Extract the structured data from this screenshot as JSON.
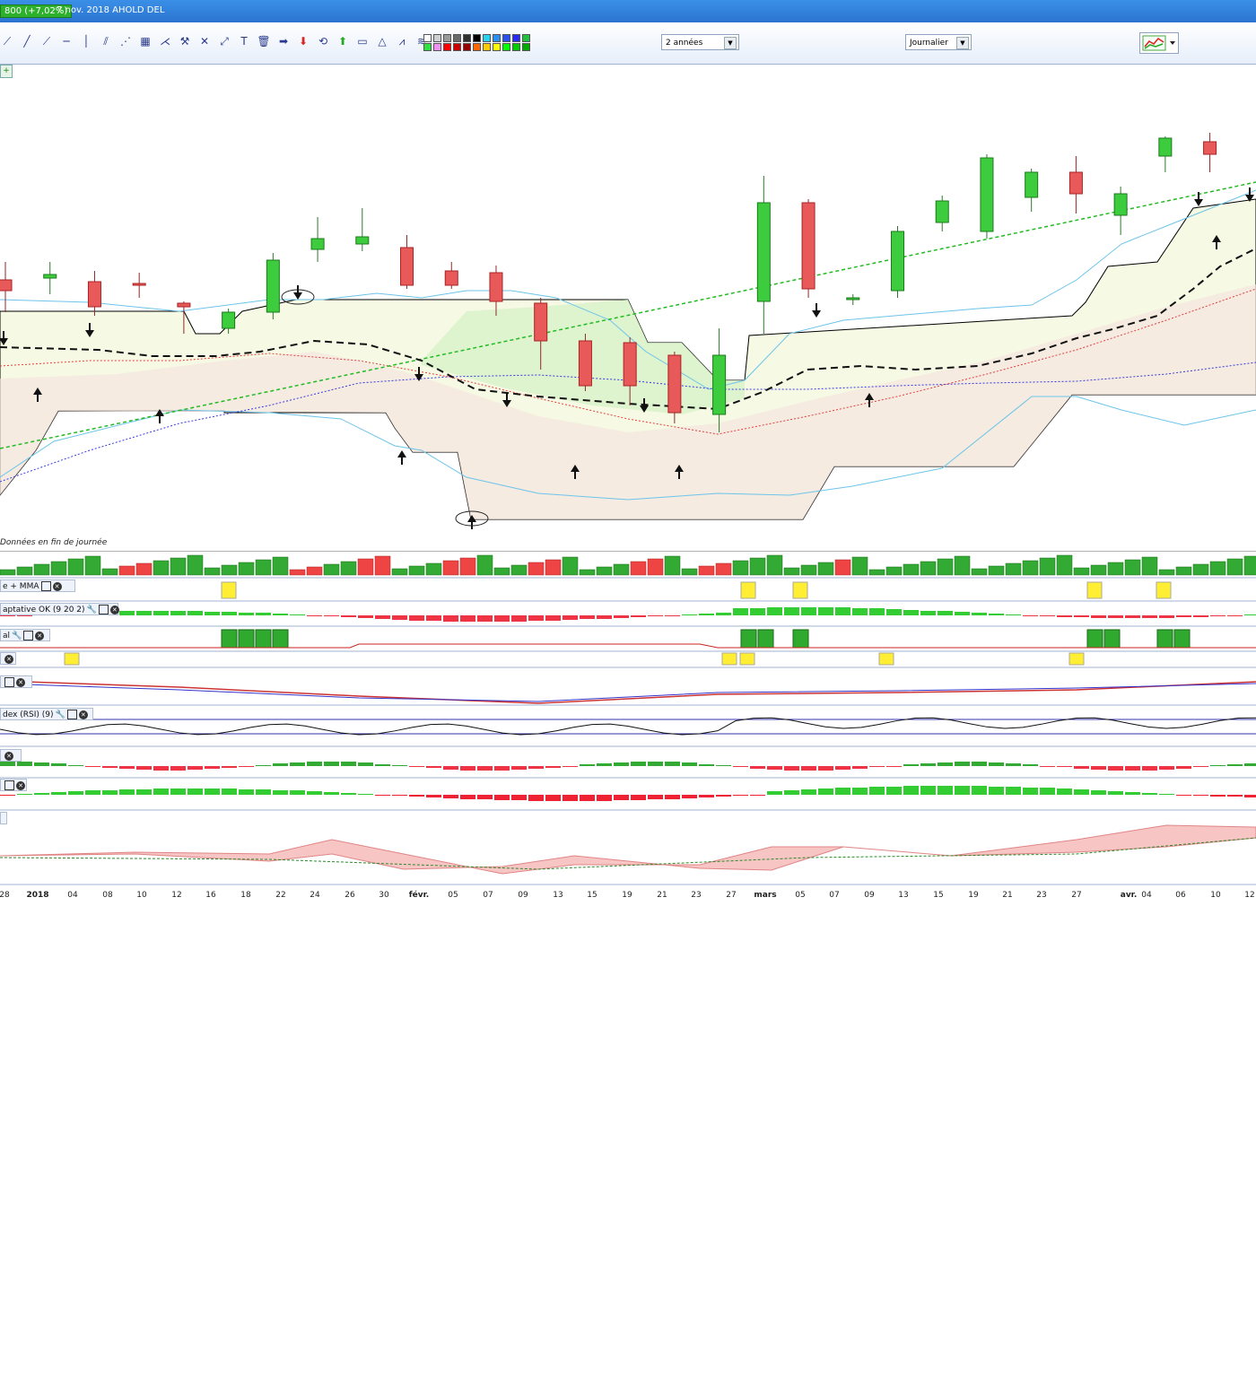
{
  "window": {
    "price_badge": "800 (+7,02%)",
    "title": "7 nov. 2018 AHOLD DEL"
  },
  "toolbar": {
    "period_value": "2 années",
    "interval_value": "Journalier",
    "drawing_tools": [
      "cursor-icon",
      "line-icon",
      "trendline-icon",
      "horizontal-line-icon",
      "vertical-line-icon",
      "channel-icon",
      "fan-icon",
      "grid-icon",
      "gann-icon",
      "hammer-icon",
      "cross-icon",
      "ray-icon",
      "text-icon",
      "trash-icon",
      "arrow-right-icon",
      "arrow-down-icon",
      "rotate-icon",
      "arrow-up-icon",
      "rectangle-icon",
      "triangle-icon",
      "zigzag-icon",
      "fibonacci-icon"
    ],
    "colors": [
      "#ffffff",
      "#d0d0d0",
      "#9a9a9a",
      "#6a6a6a",
      "#303030",
      "#000000",
      "#2ad0f0",
      "#2a90f0",
      "#2a50f0",
      "#2a2af0",
      "#20c040",
      "#30e040",
      "#f090f0",
      "#ff0000",
      "#cc0000",
      "#990000",
      "#ff6600",
      "#ffcc00",
      "#ffff00",
      "#00ff00",
      "#00cc00",
      "#00aa00"
    ]
  },
  "chart": {
    "data_note": "Données en fin de journée"
  },
  "panels": [
    {
      "label": "e + MMA"
    },
    {
      "label": "aptative OK (9 20 2)"
    },
    {
      "label": "al"
    },
    {
      "label": ""
    },
    {
      "label": ""
    },
    {
      "label": "dex (RSI) (9)"
    },
    {
      "label": ""
    },
    {
      "label": ""
    },
    {
      "label": ""
    }
  ],
  "x_axis": [
    "28",
    "2018",
    "04",
    "08",
    "10",
    "12",
    "16",
    "18",
    "22",
    "24",
    "26",
    "30",
    "févr.",
    "05",
    "07",
    "09",
    "13",
    "15",
    "19",
    "21",
    "23",
    "27",
    "mars",
    "05",
    "07",
    "09",
    "13",
    "15",
    "19",
    "21",
    "23",
    "27",
    "avr.",
    "04",
    "06",
    "10",
    "12"
  ],
  "chart_data": {
    "type": "candlestick",
    "title": "7 nov. 2018 AHOLD DEL",
    "x_labels": [
      "28",
      "2018",
      "04",
      "08",
      "10",
      "12",
      "16",
      "18",
      "22",
      "24",
      "26",
      "30",
      "févr.",
      "05",
      "07",
      "09",
      "13",
      "15",
      "19",
      "21",
      "23",
      "27",
      "mars",
      "05",
      "07",
      "09",
      "13",
      "15",
      "19",
      "21",
      "23",
      "27",
      "avr.",
      "04",
      "06",
      "10",
      "12"
    ],
    "series": [
      {
        "name": "",
        "bars": [
          {
            "o": 410,
            "c": 404,
            "h": 392,
            "l": 420
          },
          {
            "o": 411,
            "c": 413,
            "h": 402,
            "l": 420
          },
          {
            "o": 409,
            "c": 395,
            "h": 390,
            "l": 415
          },
          {
            "o": 408,
            "c": 407,
            "h": 400,
            "l": 414
          },
          {
            "o": 397,
            "c": 395,
            "h": 380,
            "l": 398
          },
          {
            "o": 383,
            "c": 392,
            "h": 380,
            "l": 394
          },
          {
            "o": 392,
            "c": 421,
            "h": 388,
            "l": 425
          },
          {
            "o": 427,
            "c": 433,
            "h": 420,
            "l": 445
          },
          {
            "o": 430,
            "c": 434,
            "h": 426,
            "l": 450
          },
          {
            "o": 428,
            "c": 407,
            "h": 405,
            "l": 435
          },
          {
            "o": 415,
            "c": 407,
            "h": 405,
            "l": 420
          },
          {
            "o": 414,
            "c": 398,
            "h": 390,
            "l": 418
          },
          {
            "o": 397,
            "c": 376,
            "h": 360,
            "l": 400
          },
          {
            "o": 376,
            "c": 351,
            "h": 348,
            "l": 380
          },
          {
            "o": 375,
            "c": 351,
            "h": 340,
            "l": 378
          },
          {
            "o": 368,
            "c": 336,
            "h": 330,
            "l": 370
          },
          {
            "o": 335,
            "c": 368,
            "h": 325,
            "l": 383
          },
          {
            "o": 398,
            "c": 453,
            "h": 380,
            "l": 468
          },
          {
            "o": 453,
            "c": 405,
            "h": 400,
            "l": 455
          },
          {
            "o": 399,
            "c": 400,
            "h": 396,
            "l": 402
          },
          {
            "o": 404,
            "c": 437,
            "h": 400,
            "l": 440
          },
          {
            "o": 442,
            "c": 454,
            "h": 437,
            "l": 457
          },
          {
            "o": 437,
            "c": 478,
            "h": 433,
            "l": 480
          },
          {
            "o": 456,
            "c": 470,
            "h": 448,
            "l": 472
          },
          {
            "o": 470,
            "c": 458,
            "h": 447,
            "l": 479
          },
          {
            "o": 446,
            "c": 458,
            "h": 435,
            "l": 462
          },
          {
            "o": 479,
            "c": 489,
            "h": 470,
            "l": 490
          },
          {
            "o": 487,
            "c": 480,
            "h": 470,
            "l": 492
          }
        ]
      }
    ]
  }
}
